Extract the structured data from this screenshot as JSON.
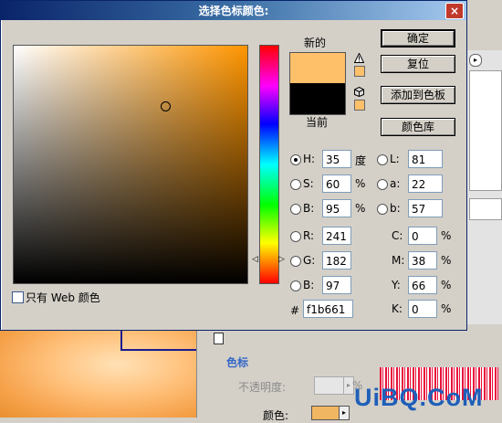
{
  "dialog": {
    "title": "选择色标颜色:",
    "close_label": "×",
    "new_label": "新的",
    "current_label": "当前",
    "new_color": "#ffc06a",
    "current_color": "#000000",
    "buttons": {
      "ok": "确定",
      "reset": "复位",
      "add_swatch": "添加到色板",
      "libraries": "颜色库"
    },
    "only_web_colors": "只有 Web 颜色",
    "hsb": {
      "h_label": "H:",
      "h": "35",
      "h_unit": "度",
      "s_label": "S:",
      "s": "60",
      "s_unit": "%",
      "b_label": "B:",
      "b": "95",
      "b_unit": "%"
    },
    "lab": {
      "l_label": "L:",
      "l": "81",
      "a_label": "a:",
      "a": "22",
      "b_label": "b:",
      "b": "57"
    },
    "rgb": {
      "r_label": "R:",
      "r": "241",
      "g_label": "G:",
      "g": "182",
      "b_label": "B:",
      "b": "97"
    },
    "cmyk": {
      "c_label": "C:",
      "c": "0",
      "m_label": "M:",
      "m": "38",
      "y_label": "Y:",
      "y": "66",
      "k_label": "K:",
      "k": "0",
      "unit": "%"
    },
    "hex_label": "#",
    "hex": "f1b661",
    "hue_markers": {
      "left": "◁",
      "right": "▷"
    }
  },
  "background": {
    "panel_section_label": "色标",
    "opacity_label": "不透明度:",
    "opacity_unit": "%",
    "color_label": "颜色:",
    "color_value": "#f1b661"
  },
  "watermark": "UiBQ.CoM"
}
